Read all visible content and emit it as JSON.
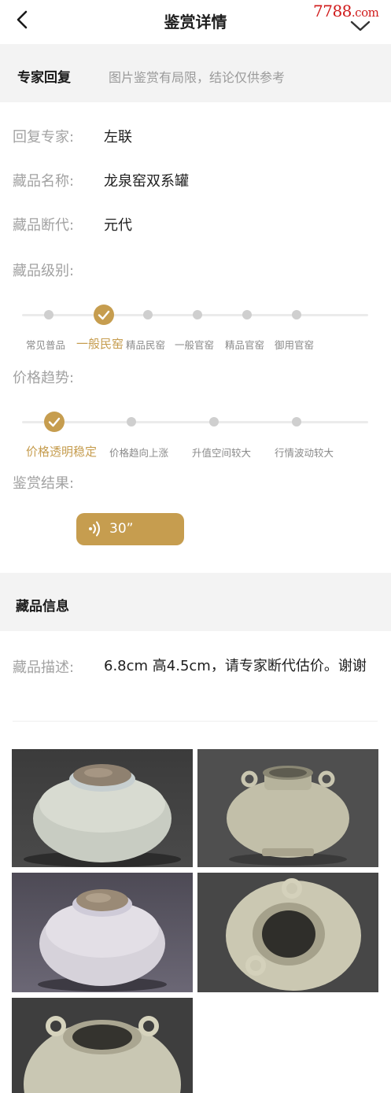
{
  "header": {
    "title": "鉴赏详情",
    "watermark_main": "7788",
    "watermark_suffix": ".com",
    "icons": {
      "back": "chevron-left-icon",
      "share": "share-icon"
    }
  },
  "expert_reply": {
    "heading": "专家回复",
    "disclaimer": "图片鉴赏有局限，结论仅供参考",
    "expert_label": "回复专家:",
    "expert_value": "左联",
    "name_label": "藏品名称:",
    "name_value": "龙泉窑双系罐",
    "era_label": "藏品断代:",
    "era_value": "元代",
    "grade_label": "藏品级别:",
    "grade_levels": [
      "常见普品",
      "一般民窑",
      "精品民窑",
      "一般官窑",
      "精品官窑",
      "御用官窑"
    ],
    "grade_selected_index": 1,
    "trend_label": "价格趋势:",
    "trend_levels": [
      "价格透明稳定",
      "价格趋向上涨",
      "升值空间较大",
      "行情波动较大"
    ],
    "trend_selected_index": 0,
    "result_label": "鉴赏结果:",
    "audio_duration": "30”"
  },
  "collection_info": {
    "heading": "藏品信息",
    "desc_label": "藏品描述:",
    "desc_value": "6.8cm 高4.5cm，请专家断代估价。谢谢",
    "photos": [
      "jar-top-view",
      "jar-side-view",
      "jar-top-view-2",
      "jar-mouth-view",
      "jar-mouth-view-2"
    ]
  },
  "colors": {
    "accent": "#c69d4f",
    "section_bg": "#f3f3f3",
    "watermark": "#d01a1a"
  }
}
